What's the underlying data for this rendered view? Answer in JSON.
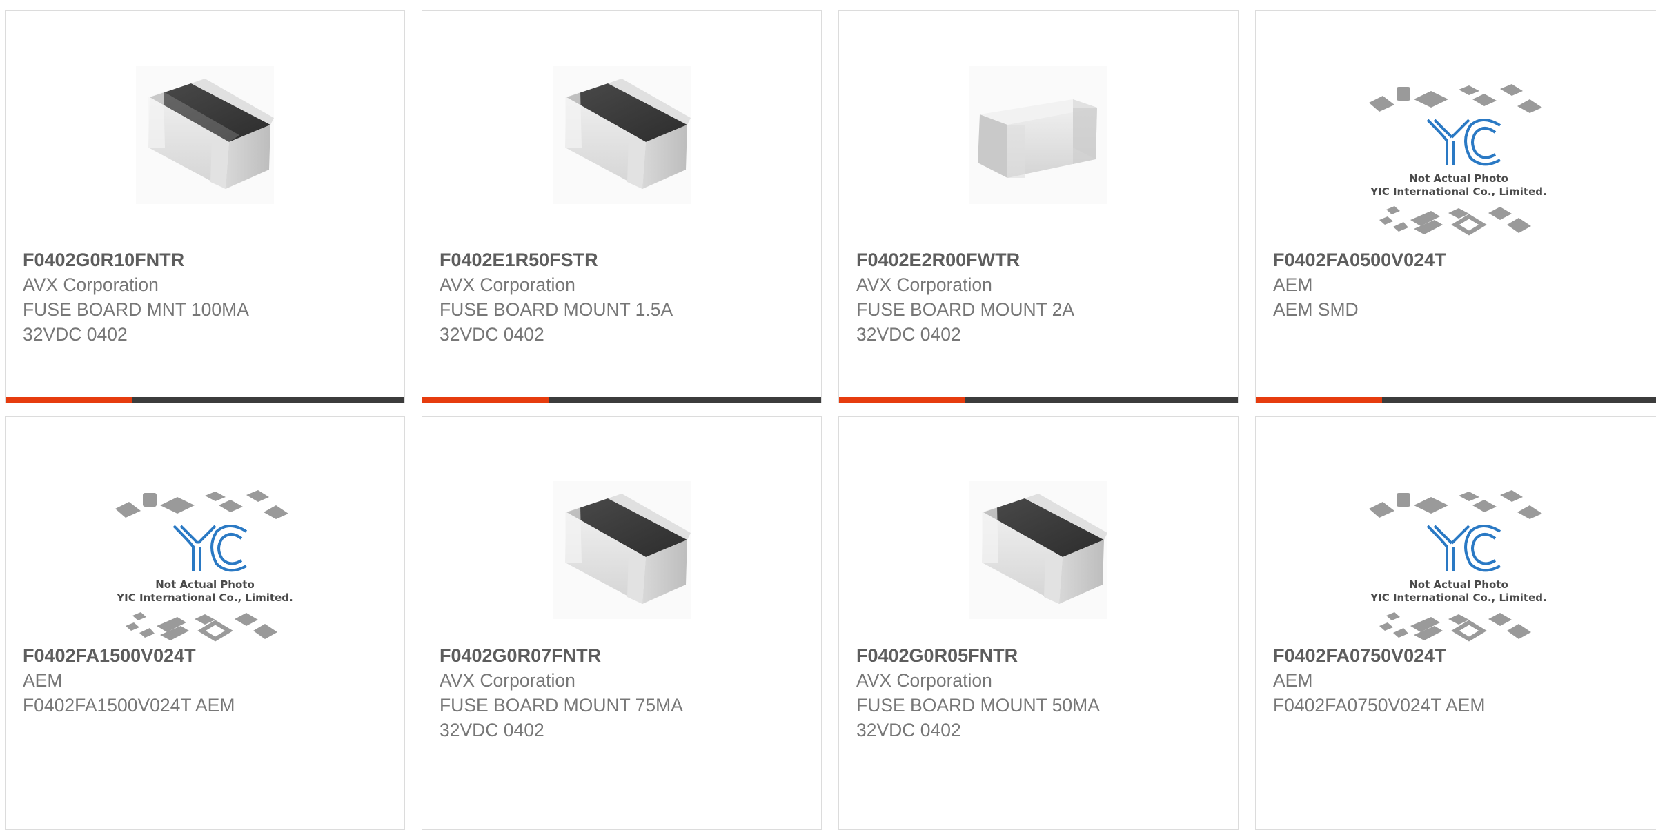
{
  "colors": {
    "accent": "#e63c0e",
    "bar_dark": "#3c3c3c",
    "border": "#dcdcdc",
    "text_title": "#5d5d5d",
    "text_body": "#777777"
  },
  "products": [
    {
      "part": "F0402G0R10FNTR",
      "maker": "AVX Corporation",
      "desc": [
        "FUSE BOARD MNT 100MA",
        "32VDC 0402"
      ],
      "image": "chip-dark-top"
    },
    {
      "part": "F0402E1R50FSTR",
      "maker": "AVX Corporation",
      "desc": [
        "FUSE BOARD MOUNT 1.5A",
        "32VDC 0402"
      ],
      "image": "chip-dark-top"
    },
    {
      "part": "F0402E2R00FWTR",
      "maker": "AVX Corporation",
      "desc": [
        "FUSE BOARD MOUNT 2A",
        "32VDC 0402"
      ],
      "image": "chip-white"
    },
    {
      "part": "F0402FA0500V024T",
      "maker": "AEM",
      "desc": [
        "AEM SMD"
      ],
      "image": "yic-placeholder"
    },
    {
      "part": "F0402FA1500V024T",
      "maker": "AEM",
      "desc": [
        "F0402FA1500V024T AEM"
      ],
      "image": "yic-placeholder"
    },
    {
      "part": "F0402G0R07FNTR",
      "maker": "AVX Corporation",
      "desc": [
        "FUSE BOARD MOUNT 75MA",
        "32VDC 0402"
      ],
      "image": "chip-dark-top"
    },
    {
      "part": "F0402G0R05FNTR",
      "maker": "AVX Corporation",
      "desc": [
        "FUSE BOARD MOUNT 50MA",
        "32VDC 0402"
      ],
      "image": "chip-dark-top"
    },
    {
      "part": "F0402FA0750V024T",
      "maker": "AEM",
      "desc": [
        "F0402FA0750V024T AEM"
      ],
      "image": "yic-placeholder"
    }
  ],
  "placeholder": {
    "line1": "Not Actual Photo",
    "line2": "YIC International Co., Limited."
  }
}
